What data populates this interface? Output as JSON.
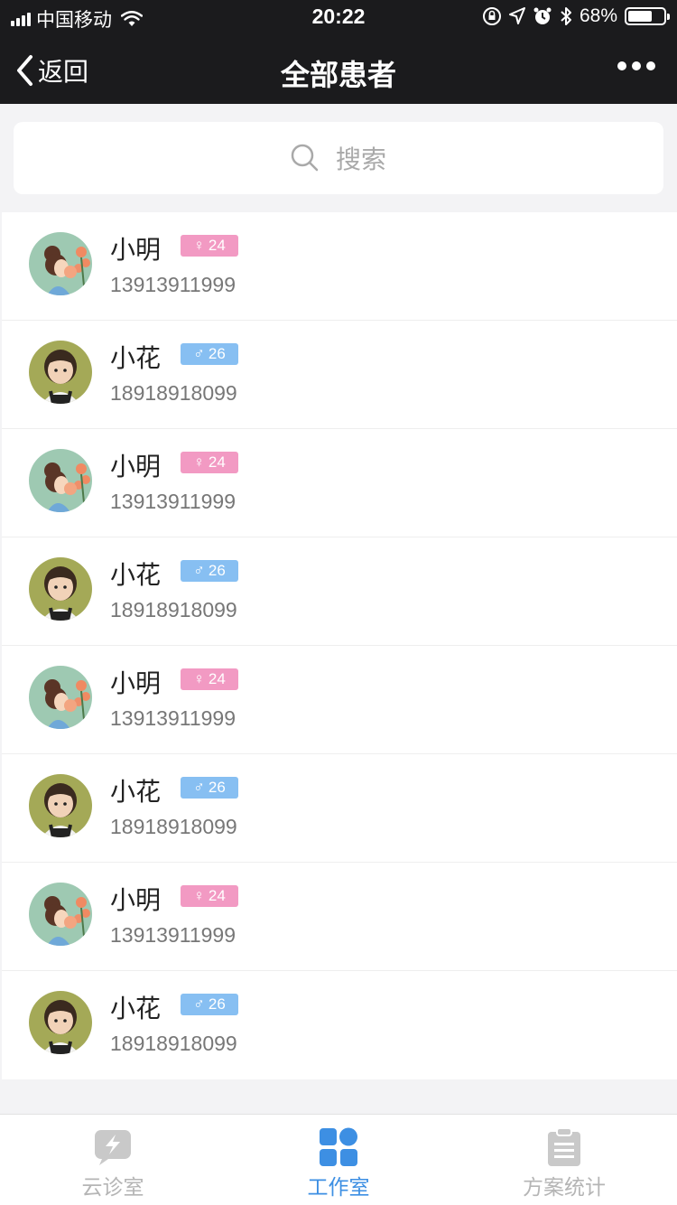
{
  "status_bar": {
    "carrier": "中国移动",
    "time": "20:22",
    "battery_percent": "68%",
    "battery_level": 0.68,
    "icons": [
      "signal-icon",
      "wifi-icon",
      "orientation-lock-icon",
      "location-icon",
      "alarm-icon",
      "bluetooth-icon",
      "battery-icon"
    ]
  },
  "nav": {
    "back_label": "返回",
    "title": "全部患者",
    "more_icon": "more-dots-icon"
  },
  "search": {
    "placeholder": "搜索",
    "icon": "search-icon"
  },
  "patients": [
    {
      "name": "小明",
      "gender": "female",
      "gender_symbol": "♀",
      "age": "24",
      "phone": "13913911999",
      "avatar": "illustrated-girl-avatar"
    },
    {
      "name": "小花",
      "gender": "male",
      "gender_symbol": "♂",
      "age": "26",
      "phone": "18918918099",
      "avatar": "child-photo-avatar"
    },
    {
      "name": "小明",
      "gender": "female",
      "gender_symbol": "♀",
      "age": "24",
      "phone": "13913911999",
      "avatar": "illustrated-girl-avatar"
    },
    {
      "name": "小花",
      "gender": "male",
      "gender_symbol": "♂",
      "age": "26",
      "phone": "18918918099",
      "avatar": "child-photo-avatar"
    },
    {
      "name": "小明",
      "gender": "female",
      "gender_symbol": "♀",
      "age": "24",
      "phone": "13913911999",
      "avatar": "illustrated-girl-avatar"
    },
    {
      "name": "小花",
      "gender": "male",
      "gender_symbol": "♂",
      "age": "26",
      "phone": "18918918099",
      "avatar": "child-photo-avatar"
    },
    {
      "name": "小明",
      "gender": "female",
      "gender_symbol": "♀",
      "age": "24",
      "phone": "13913911999",
      "avatar": "illustrated-girl-avatar"
    },
    {
      "name": "小花",
      "gender": "male",
      "gender_symbol": "♂",
      "age": "26",
      "phone": "18918918099",
      "avatar": "child-photo-avatar"
    }
  ],
  "tabs": [
    {
      "label": "云诊室",
      "icon": "lightning-chat-icon",
      "active": false
    },
    {
      "label": "工作室",
      "icon": "grid-icon",
      "active": true
    },
    {
      "label": "方案统计",
      "icon": "clipboard-icon",
      "active": false
    }
  ],
  "colors": {
    "header_bg": "#1b1b1d",
    "female_badge": "#f29ac3",
    "male_badge": "#87bff2",
    "active_tab": "#3d8fe3",
    "inactive_tab": "#b5b5b5"
  }
}
